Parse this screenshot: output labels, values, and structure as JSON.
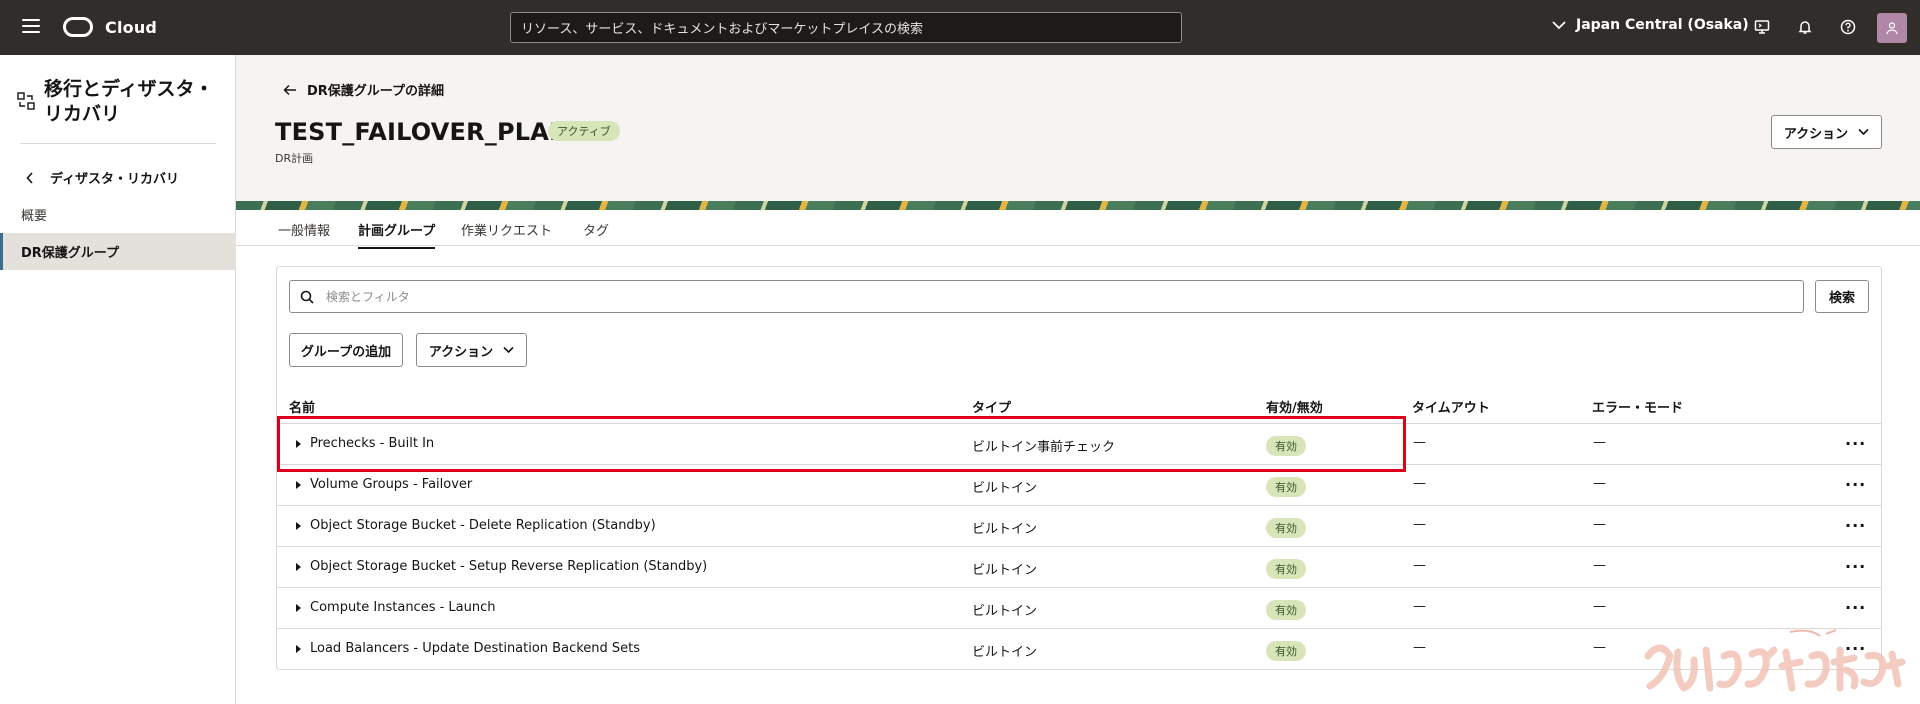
{
  "topbar": {
    "brand": "Cloud",
    "search_placeholder": "リソース、サービス、ドキュメントおよびマーケットプレイスの検索",
    "region": "Japan Central (Osaka)"
  },
  "sidebar": {
    "title": "移行とディザスタ・リカバリ",
    "back_label": "ディザスタ・リカバリ",
    "overview_label": "概要",
    "selected_label": "DR保護グループ"
  },
  "header": {
    "back_link": "DR保護グループの詳細",
    "title": "TEST_FAILOVER_PLAN",
    "status": "アクティブ",
    "subtitle": "DR計画",
    "action_label": "アクション"
  },
  "tabs": [
    "一般情報",
    "計画グループ",
    "作業リクエスト",
    "タグ"
  ],
  "toolbar": {
    "filter_placeholder": "検索とフィルタ",
    "search_label": "検索",
    "add_group_label": "グループの追加",
    "action_label": "アクション"
  },
  "table": {
    "columns": [
      "名前",
      "タイプ",
      "有効/無効",
      "タイムアウト",
      "エラー・モード"
    ],
    "rows": [
      {
        "name": "Prechecks - Built In",
        "type": "ビルトイン事前チェック",
        "status": "有効",
        "timeout": "—",
        "error_mode": "—"
      },
      {
        "name": "Volume Groups - Failover",
        "type": "ビルトイン",
        "status": "有効",
        "timeout": "—",
        "error_mode": "—"
      },
      {
        "name": "Object Storage Bucket - Delete Replication (Standby)",
        "type": "ビルトイン",
        "status": "有効",
        "timeout": "—",
        "error_mode": "—"
      },
      {
        "name": "Object Storage Bucket - Setup Reverse Replication (Standby)",
        "type": "ビルトイン",
        "status": "有効",
        "timeout": "—",
        "error_mode": "—"
      },
      {
        "name": "Compute Instances - Launch",
        "type": "ビルトイン",
        "status": "有効",
        "timeout": "—",
        "error_mode": "—"
      },
      {
        "name": "Load Balancers - Update Destination Backend Sets",
        "type": "ビルトイン",
        "status": "有効",
        "timeout": "—",
        "error_mode": "—"
      }
    ],
    "row_menu": "···"
  },
  "watermark": "ひとりでできるもん",
  "colors": {
    "accent": "#3b6e8f",
    "badge_bg": "#d7e5b8",
    "highlight": "#e0001b",
    "topbar": "#312d2a"
  }
}
